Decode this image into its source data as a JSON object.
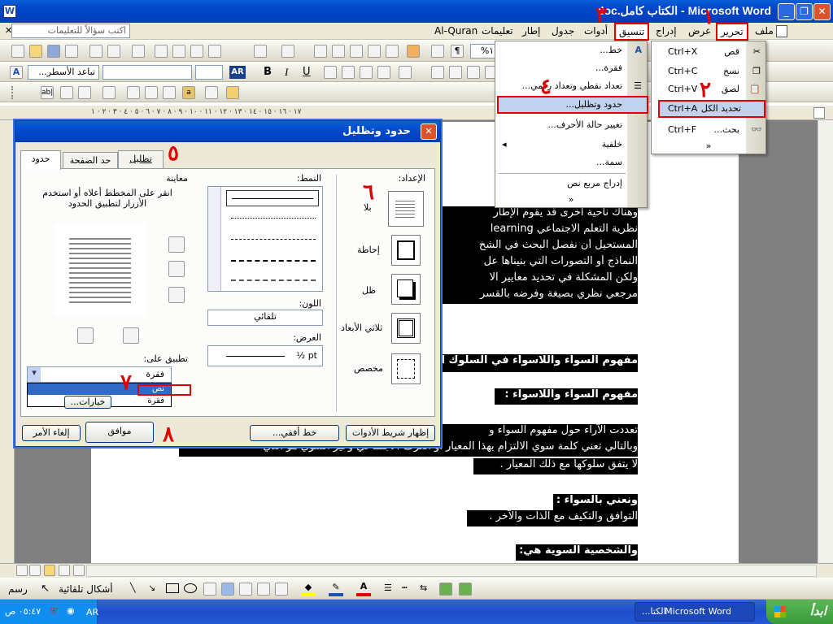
{
  "titlebar": {
    "title": "Microsoft Word - الكتاب كامل.doc",
    "buttons": [
      "_",
      "❐",
      "✕"
    ]
  },
  "menubar": {
    "items": [
      "ملف",
      "تحرير",
      "عرض",
      "إدراج",
      "تنسيق",
      "أدوات",
      "جدول",
      "إطار",
      "تعليمات",
      "Al-Quran"
    ],
    "help_placeholder": "اكتب سؤالاً للتعليمات"
  },
  "toolbar": {
    "zoom": "١٠٠%",
    "style": "تباعد الأسطر...",
    "font_lang": "AR",
    "bold": "B",
    "italic": "I",
    "underline": "U"
  },
  "ruler": {
    "text": "١٧ · ١٦ · ١٥ · ١٤ · ١٣ · ١٢ · ١١ · ١٠ · ٩ · ٨ · ٧ · ٦ · ٥ · ٤ · ٣ · ٢ · ١"
  },
  "edit_menu": {
    "items": [
      {
        "label": "قص",
        "shortcut": "Ctrl+X"
      },
      {
        "label": "نسخ",
        "shortcut": "Ctrl+C"
      },
      {
        "label": "لصق",
        "shortcut": "Ctrl+V"
      },
      {
        "label": "تحديد الكل",
        "shortcut": "Ctrl+A"
      },
      {
        "label": "بحث...",
        "shortcut": "Ctrl+F"
      }
    ],
    "more": "»"
  },
  "format_menu": {
    "items": [
      "خط...",
      "فقرة...",
      "تعداد نقطي وتعداد رقمي...",
      "حدود وتظليل...",
      "تغيير حالة الأحرف...",
      "خلفية",
      "سمة...",
      "إدراج مربع نص"
    ],
    "more": "»"
  },
  "document": {
    "lines": [
      "وهناك ناحية أخرى قد يقوم الإطار",
      "نظرية التعلم الاجتماعي learning",
      "المستحيل أن نفصل البحث في الشخ",
      "النماذج أو التصورات التي بنيناها عل",
      "ولكن المشكلة في تحديد معايير الا",
      "مرجعي نظري بصيغة وفرضه بالقسر",
      "مفهوم السواء واللاسواء في السلوك الإ",
      "مفهوم السواء واللاسواء :",
      "تعددت الآراء حول مفهوم السواء و",
      "وبالتالي تعني كلمة سوي الالتزام بهذا المعيار أو العرف الاجتماعي وغير السوي هو الذي",
      "لا يتفق سلوكها مع ذلك المعيار .",
      "ونعني بالسواء :",
      "التوافق والتكيف مع الذات والآخر .",
      "والشخصية السوية هي:"
    ]
  },
  "dialog": {
    "title": "حدود وتظليل",
    "tabs": [
      "حدود",
      "حد الصفحة",
      "تظليل"
    ],
    "setting_label": "الإعداد:",
    "settings": [
      "بلا",
      "إحاطة",
      "ظل",
      "ثلاثي الأبعاد",
      "مخصص"
    ],
    "style_label": "النمط:",
    "color_label": "اللون:",
    "color_value": "تلقائي",
    "width_label": "العرض:",
    "width_value": "½ pt",
    "preview_label": "معاينة",
    "preview_hint": "انقر على المخطط أعلاه أو استخدم الأزرار لتطبيق الحدود",
    "apply_label": "تطبيق على:",
    "apply_value": "فقرة",
    "apply_options": [
      "نص",
      "فقرة"
    ],
    "options_button": "خيارات...",
    "toolbar_button": "إظهار شريط الأدوات",
    "hline_button": "خط أفقي...",
    "ok_button": "موافق",
    "cancel_button": "إلغاء الأمر"
  },
  "annotations": [
    "١",
    "٢",
    "٣",
    "٤",
    "٥",
    "٦",
    "٧",
    "٨"
  ],
  "drawing_toolbar": {
    "draw": "رسم",
    "autoshapes": "أشكال تلقائية"
  },
  "statusbar": {
    "lang": "AR"
  },
  "taskbar": {
    "start": "ابدأ",
    "task1": "Microsoft Word",
    "task2": "الكتا...",
    "clock": "٠٥:٤٧ ص",
    "lang": "AR"
  }
}
